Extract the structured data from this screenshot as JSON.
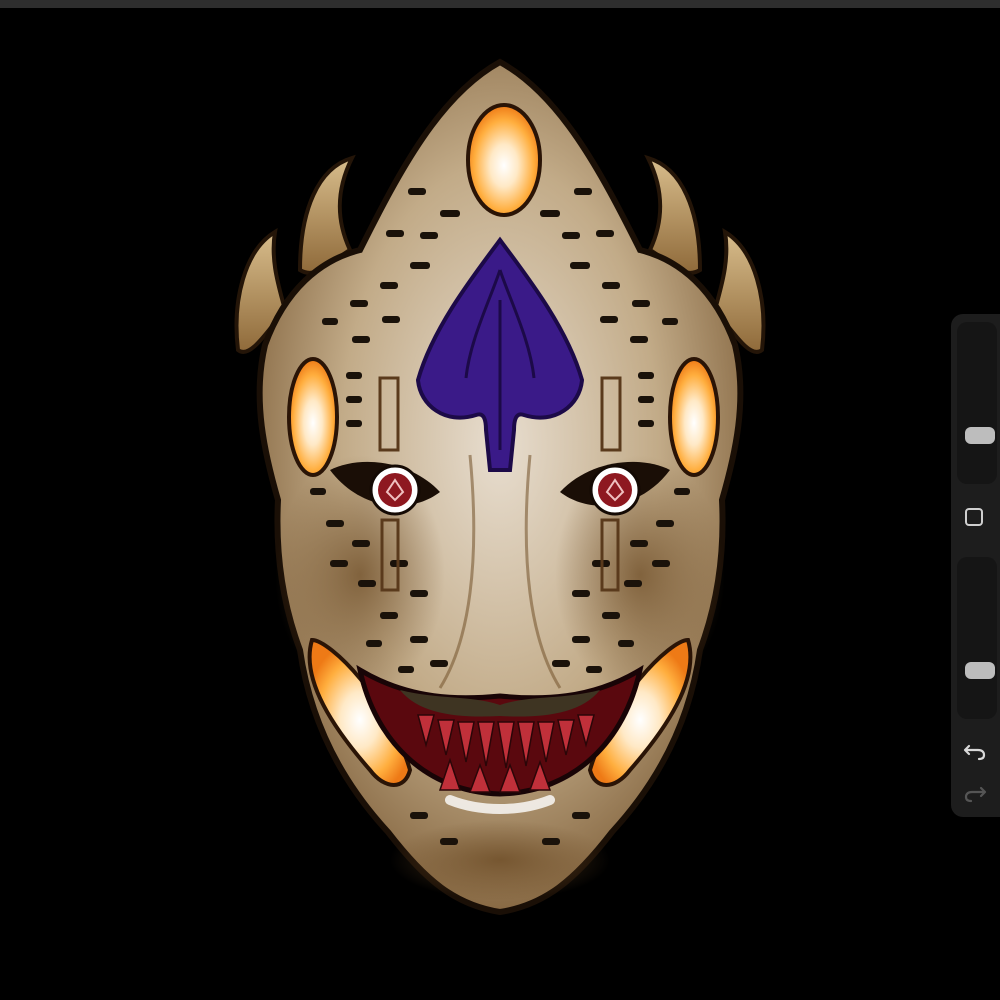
{
  "app": {
    "colors": {
      "background": "#000000",
      "sidebar": "#1d1d1d",
      "top_bar": "#2e2e2e",
      "control": "#bdbdbd"
    }
  },
  "sidebar": {
    "brush_size_slider": {
      "level": 0.25
    },
    "opacity_slider": {
      "level": 0.25
    },
    "icons": {
      "modify": "square-outline-icon",
      "undo": "undo-arrow-icon",
      "redo": "redo-arrow-icon"
    }
  },
  "artwork": {
    "subject": "ornate-mask-illustration",
    "colors": {
      "mask_base": "#c8b69a",
      "gem_glow": "#ffb24a",
      "forehead_emblem": "#3c1c86",
      "mouth": "#6a0c12",
      "eyes": "#8e1820"
    }
  }
}
